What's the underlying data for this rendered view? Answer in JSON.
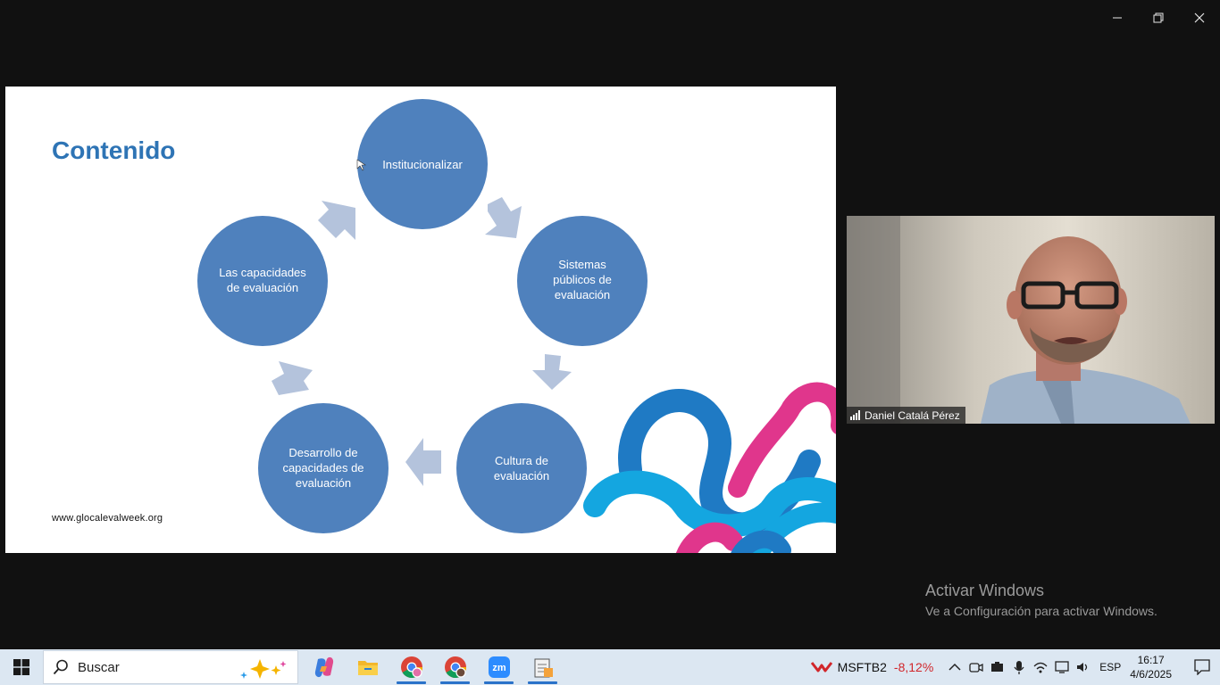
{
  "slide": {
    "title": "Contenido",
    "url": "www.glocalevalweek.org",
    "cycle_nodes": [
      {
        "lines": [
          "Institucionalizar"
        ]
      },
      {
        "lines": [
          "Sistemas",
          "públicos de",
          "evaluación"
        ]
      },
      {
        "lines": [
          "Cultura de",
          "evaluación"
        ]
      },
      {
        "lines": [
          "Desarrollo de",
          "capacidades de",
          "evaluación"
        ]
      },
      {
        "lines": [
          "Las capacidades",
          "de evaluación"
        ]
      }
    ],
    "colors": {
      "title": "#2e74b5",
      "node": "#4f81bd",
      "arrow": "#b4c3dc",
      "deco_blue": "#1f7ac4",
      "deco_cyan": "#14a6e0",
      "deco_pink": "#e0368c"
    }
  },
  "video": {
    "participant_name": "Daniel Catalá Pérez",
    "icons": {
      "signal": "signal-strength-icon"
    }
  },
  "watermark": {
    "title": "Activar Windows",
    "subtitle": "Ve a Configuración para activar Windows."
  },
  "taskbar": {
    "search_placeholder": "Buscar",
    "apps": [
      "copilot-icon",
      "file-explorer-icon",
      "chrome-icon",
      "chrome-profile-icon",
      "zoom-icon",
      "notepad-icon"
    ],
    "stock": {
      "name": "MSFTB2",
      "change": "-8,12%"
    },
    "language": "ESP",
    "time": "16:17",
    "date": "4/6/2025"
  }
}
